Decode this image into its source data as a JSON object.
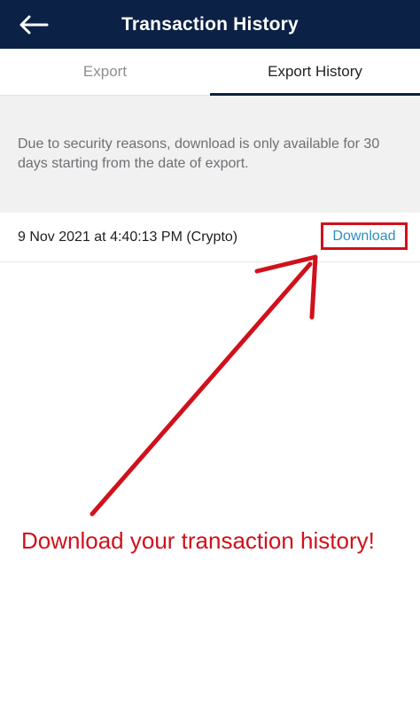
{
  "header": {
    "title": "Transaction History",
    "back_icon": "arrow-left-icon",
    "background_color": "#0b2145"
  },
  "tabs": [
    {
      "label": "Export",
      "active": false
    },
    {
      "label": "Export History",
      "active": true
    }
  ],
  "notice": {
    "text": "Due to security reasons, download is only available for 30 days starting from the date of export."
  },
  "export_history": {
    "items": [
      {
        "label": "9 Nov 2021 at 4:40:13 PM (Crypto)",
        "action_label": "Download"
      }
    ]
  },
  "annotation": {
    "text": "Download your transaction history!",
    "color": "#d0111b"
  }
}
